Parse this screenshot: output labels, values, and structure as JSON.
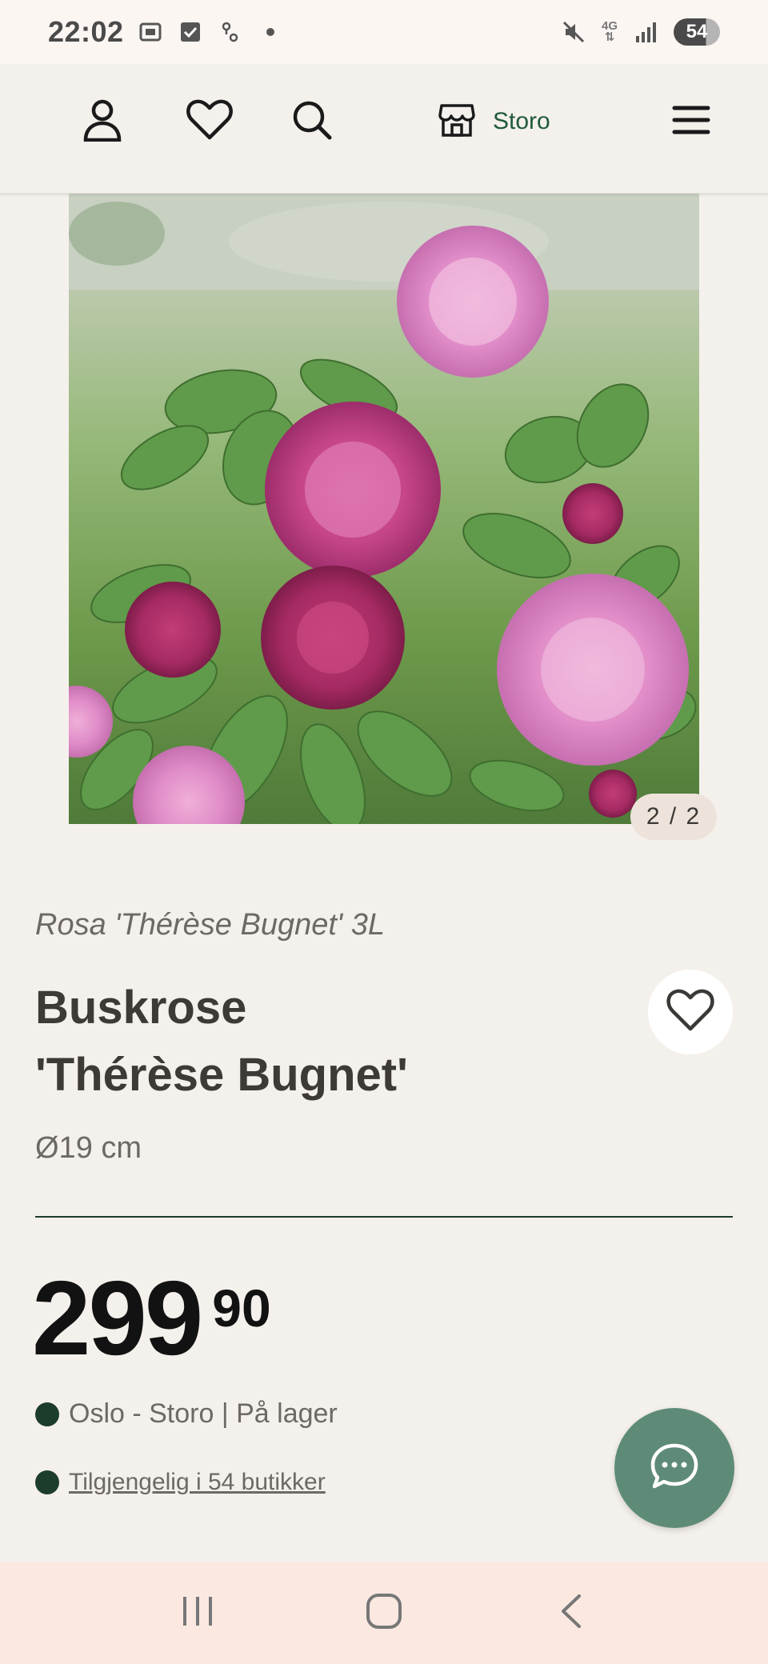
{
  "status_bar": {
    "time": "22:02",
    "network": "4G",
    "battery": "54"
  },
  "header": {
    "store_name": "Storo",
    "icons": [
      "user-icon",
      "heart-icon",
      "search-icon",
      "store-icon",
      "menu-icon"
    ]
  },
  "gallery": {
    "counter": "2 / 2",
    "current": 2,
    "total": 2
  },
  "product": {
    "latin_name": "Rosa 'Thérèse Bugnet' 3L",
    "title_line1": "Buskrose",
    "title_line2": "'Thérèse Bugnet'",
    "size": "Ø19 cm",
    "price_main": "299",
    "price_decimal": "90"
  },
  "stock": {
    "local": "Oslo - Storo | På lager",
    "availability_link": "Tilgjengelig i 54 butikker"
  },
  "colors": {
    "accent_green": "#1d3d2c",
    "store_green": "#1f5a3a",
    "chat_button": "#5e8b77",
    "background": "#f4f0ec"
  },
  "nav": {
    "icons": [
      "recents-icon",
      "home-icon",
      "back-icon"
    ]
  }
}
